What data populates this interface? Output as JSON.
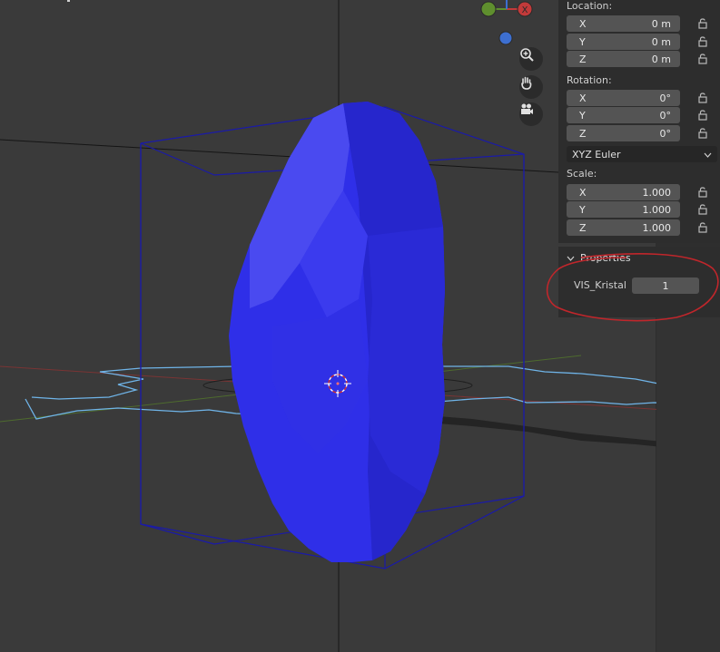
{
  "transform": {
    "location": {
      "label": "Location:",
      "rows": [
        {
          "axis": "X",
          "value": "0 m"
        },
        {
          "axis": "Y",
          "value": "0 m"
        },
        {
          "axis": "Z",
          "value": "0 m"
        }
      ]
    },
    "rotation": {
      "label": "Rotation:",
      "rows": [
        {
          "axis": "X",
          "value": "0°"
        },
        {
          "axis": "Y",
          "value": "0°"
        },
        {
          "axis": "Z",
          "value": "0°"
        }
      ],
      "mode": "XYZ Euler"
    },
    "scale": {
      "label": "Scale:",
      "rows": [
        {
          "axis": "X",
          "value": "1.000"
        },
        {
          "axis": "Y",
          "value": "1.000"
        },
        {
          "axis": "Z",
          "value": "1.000"
        }
      ]
    }
  },
  "properties": {
    "header": "Properties",
    "prop_name": "VIS_Kristal",
    "prop_value": "1"
  },
  "gizmo": {
    "x_label": "X"
  },
  "icons": {
    "zoom": "zoom-icon",
    "pan": "hand-icon",
    "camera": "camera-icon",
    "lock": "lock-icon",
    "chevron": "chevron-down-icon"
  },
  "colors": {
    "object": "#2f2fe8",
    "bbox": "#1a1aa8",
    "curve": "#6fb4e8",
    "annotation": "#c0262b"
  }
}
